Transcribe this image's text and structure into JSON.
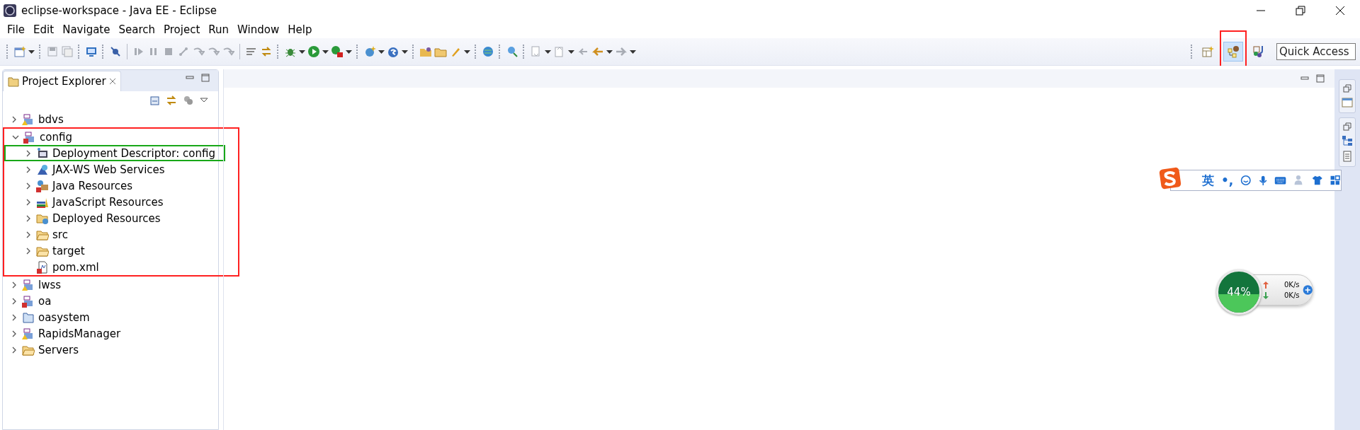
{
  "window": {
    "title": "eclipse-workspace - Java EE - Eclipse"
  },
  "menu": [
    "File",
    "Edit",
    "Navigate",
    "Search",
    "Project",
    "Run",
    "Window",
    "Help"
  ],
  "perspectives": [
    {
      "kind": "open",
      "selected": false
    },
    {
      "kind": "jee",
      "selected": true,
      "color": "#ff2020"
    },
    {
      "kind": "java",
      "selected": false
    }
  ],
  "quick_access": {
    "placeholder": "Quick Access"
  },
  "explorer": {
    "tab": {
      "label": "Project Explorer",
      "selected": true
    },
    "tree": [
      {
        "label": "bdvs",
        "kind": "maven-warning",
        "expanded": false
      },
      {
        "label": "config",
        "kind": "maven-error",
        "expanded": true,
        "color": "#ff2020",
        "children": [
          {
            "label": "Deployment Descriptor: config",
            "kind": "descriptor",
            "expanded": false,
            "color": "#18a818"
          },
          {
            "label": "JAX-WS Web Services",
            "kind": "webservice",
            "expanded": false
          },
          {
            "label": "Java Resources",
            "kind": "java-res",
            "expanded": false
          },
          {
            "label": "JavaScript Resources",
            "kind": "js-res",
            "expanded": false
          },
          {
            "label": "Deployed Resources",
            "kind": "deployed",
            "expanded": false
          },
          {
            "label": "src",
            "kind": "folder",
            "expanded": false
          },
          {
            "label": "target",
            "kind": "folder",
            "expanded": false
          },
          {
            "label": "pom.xml",
            "kind": "pom"
          }
        ]
      },
      {
        "label": "lwss",
        "kind": "maven-warning",
        "expanded": false
      },
      {
        "label": "oa",
        "kind": "maven-error",
        "expanded": false
      },
      {
        "label": "oasystem",
        "kind": "project",
        "expanded": false
      },
      {
        "label": "RapidsManager",
        "kind": "maven-warning",
        "expanded": false
      },
      {
        "label": "Servers",
        "kind": "folder",
        "expanded": false
      }
    ]
  },
  "ime_bar": {
    "mode": "英",
    "punctuation": "•,"
  },
  "net_monitor": {
    "usage": "44%",
    "upload": "0K/s",
    "download": "0K/s"
  }
}
